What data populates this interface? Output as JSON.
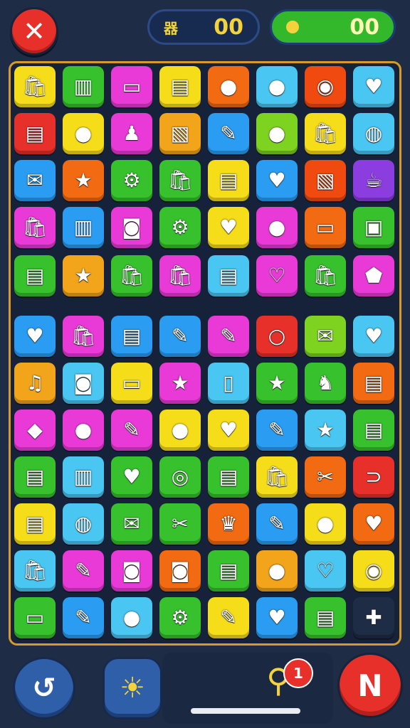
{
  "header": {
    "close_icon": "✕",
    "left_counter": {
      "label": "器",
      "value": "00"
    },
    "right_counter": {
      "value": "00"
    }
  },
  "board": {
    "rows": [
      [
        [
          "#f6dd1a",
          "clipboard-icon",
          "🛍"
        ],
        [
          "#37c22d",
          "flag-icon",
          "▥"
        ],
        [
          "#e93ad8",
          "tablet-icon",
          "▭"
        ],
        [
          "#f6dd1a",
          "card-icon",
          "▤"
        ],
        [
          "#f26a12",
          "cookie-icon",
          "●"
        ],
        [
          "#49c6f2",
          "fruit-icon",
          "●"
        ],
        [
          "#f04a10",
          "disc-icon",
          "◉"
        ],
        [
          "#49c6f2",
          "heart-icon",
          "♥"
        ]
      ],
      [
        [
          "#e8302a",
          "card-icon",
          "▤"
        ],
        [
          "#f6dd1a",
          "apple-icon",
          "●"
        ],
        [
          "#e93ad8",
          "bottle-icon",
          "♟"
        ],
        [
          "#f2a41a",
          "frame-icon",
          "▧"
        ],
        [
          "#2a9df2",
          "pencil-icon",
          "✎"
        ],
        [
          "#7ed320",
          "lemon-icon",
          "●"
        ],
        [
          "#f6dd1a",
          "bag-icon",
          "🛍"
        ],
        [
          "#49c6f2",
          "globe-icon",
          "◍"
        ]
      ],
      [
        [
          "#2a9df2",
          "envelope-icon",
          "✉"
        ],
        [
          "#f26a12",
          "star-icon",
          "★"
        ],
        [
          "#37c22d",
          "gear-icon",
          "⚙"
        ],
        [
          "#37c22d",
          "bag-icon",
          "🛍"
        ],
        [
          "#f6dd1a",
          "card-icon",
          "▤"
        ],
        [
          "#2a9df2",
          "heart-icon",
          "♥"
        ],
        [
          "#f04a10",
          "frame-icon",
          "▧"
        ],
        [
          "#8b3de0",
          "cup-icon",
          "☕"
        ]
      ],
      [
        [
          "#e93ad8",
          "bag-icon",
          "🛍"
        ],
        [
          "#2a9df2",
          "book-icon",
          "▥"
        ],
        [
          "#e93ad8",
          "camera-icon",
          "◙"
        ],
        [
          "#37c22d",
          "gear-icon",
          "⚙"
        ],
        [
          "#f6dd1a",
          "heart-icon",
          "♥"
        ],
        [
          "#e93ad8",
          "leaf-icon",
          "●"
        ],
        [
          "#f26a12",
          "card-icon",
          "▭"
        ],
        [
          "#37c22d",
          "jar-icon",
          "▣"
        ]
      ],
      [
        [
          "#37c22d",
          "suitcase-icon",
          "▤"
        ],
        [
          "#f2a41a",
          "star-icon",
          "★"
        ],
        [
          "#37c22d",
          "bag-icon",
          "🛍"
        ],
        [
          "#e93ad8",
          "bag-icon",
          "🛍"
        ],
        [
          "#49c6f2",
          "card-icon",
          "▤"
        ],
        [
          "#e93ad8",
          "heart-icon",
          "♡"
        ],
        [
          "#37c22d",
          "clipboard-icon",
          "🛍"
        ],
        [
          "#e93ad8",
          "shield-icon",
          "⬟"
        ]
      ],
      [
        [
          "#2a9df2",
          "heart-icon",
          "♥"
        ],
        [
          "#e93ad8",
          "bag-icon",
          "🛍"
        ],
        [
          "#2a9df2",
          "notepad-icon",
          "▤"
        ],
        [
          "#2a9df2",
          "pen-icon",
          "✎"
        ],
        [
          "#e93ad8",
          "pin-icon",
          "✎"
        ],
        [
          "#e8302a",
          "ring-icon",
          "○"
        ],
        [
          "#7ed320",
          "envelope-icon",
          "✉"
        ],
        [
          "#49c6f2",
          "heart-icon",
          "♥"
        ]
      ],
      [
        [
          "#f2a41a",
          "note-icon",
          "♫"
        ],
        [
          "#49c6f2",
          "camera-icon",
          "◙"
        ],
        [
          "#f6dd1a",
          "box-icon",
          "▭"
        ],
        [
          "#e93ad8",
          "star-icon",
          "★"
        ],
        [
          "#49c6f2",
          "phone-icon",
          "▯"
        ],
        [
          "#37c22d",
          "star-icon",
          "★"
        ],
        [
          "#37c22d",
          "fish-icon",
          "♞"
        ],
        [
          "#f26a12",
          "book-icon",
          "▤"
        ]
      ],
      [
        [
          "#e93ad8",
          "diamond-icon",
          "◆"
        ],
        [
          "#e93ad8",
          "lemon-icon",
          "●"
        ],
        [
          "#e93ad8",
          "pencil-icon",
          "✎"
        ],
        [
          "#f6dd1a",
          "candy-icon",
          "●"
        ],
        [
          "#f6dd1a",
          "heart-icon",
          "♥"
        ],
        [
          "#2a9df2",
          "pen-icon",
          "✎"
        ],
        [
          "#49c6f2",
          "star-icon",
          "★"
        ],
        [
          "#37c22d",
          "notepad-icon",
          "▤"
        ]
      ],
      [
        [
          "#37c22d",
          "card-icon",
          "▤"
        ],
        [
          "#49c6f2",
          "palette-icon",
          "▥"
        ],
        [
          "#37c22d",
          "heart-icon",
          "♥"
        ],
        [
          "#37c22d",
          "search-icon",
          "◎"
        ],
        [
          "#37c22d",
          "notepad-icon",
          "▤"
        ],
        [
          "#f6dd1a",
          "bag-icon",
          "🛍"
        ],
        [
          "#f26a12",
          "scissors-icon",
          "✂"
        ],
        [
          "#e8302a",
          "magnet-icon",
          "⊃"
        ]
      ],
      [
        [
          "#f6dd1a",
          "card-icon",
          "▤"
        ],
        [
          "#49c6f2",
          "globe-icon",
          "◍"
        ],
        [
          "#37c22d",
          "envelope-icon",
          "✉"
        ],
        [
          "#37c22d",
          "tools-icon",
          "✂"
        ],
        [
          "#f26a12",
          "cat-icon",
          "♛"
        ],
        [
          "#2a9df2",
          "pen-icon",
          "✎"
        ],
        [
          "#f6dd1a",
          "drop-icon",
          "●"
        ],
        [
          "#f26a12",
          "heart-icon",
          "♥"
        ]
      ],
      [
        [
          "#49c6f2",
          "bag-icon",
          "🛍"
        ],
        [
          "#e93ad8",
          "pencil-icon",
          "✎"
        ],
        [
          "#e93ad8",
          "camera-icon",
          "◙"
        ],
        [
          "#f26a12",
          "camera-icon",
          "◙"
        ],
        [
          "#37c22d",
          "box-icon",
          "▤"
        ],
        [
          "#f2a41a",
          "cookie-icon",
          "●"
        ],
        [
          "#49c6f2",
          "heart-icon",
          "♡"
        ],
        [
          "#f6dd1a",
          "disc-icon",
          "◉"
        ]
      ],
      [
        [
          "#37c22d",
          "paper-icon",
          "▭"
        ],
        [
          "#2a9df2",
          "pen-icon",
          "✎"
        ],
        [
          "#49c6f2",
          "tshirt-icon",
          "●"
        ],
        [
          "#37c22d",
          "gear-icon",
          "⚙"
        ],
        [
          "#f6dd1a",
          "pencil-icon",
          "✎"
        ],
        [
          "#2a9df2",
          "heart-icon",
          "♥"
        ],
        [
          "#37c22d",
          "book-icon",
          "▤"
        ],
        [
          "#1e2c46",
          "figure-icon",
          "✚"
        ]
      ]
    ]
  },
  "footer": {
    "undo_icon": "↺",
    "hint_icon": "☀",
    "search_icon": "⚲",
    "search_badge": "1",
    "next_label": "N"
  }
}
